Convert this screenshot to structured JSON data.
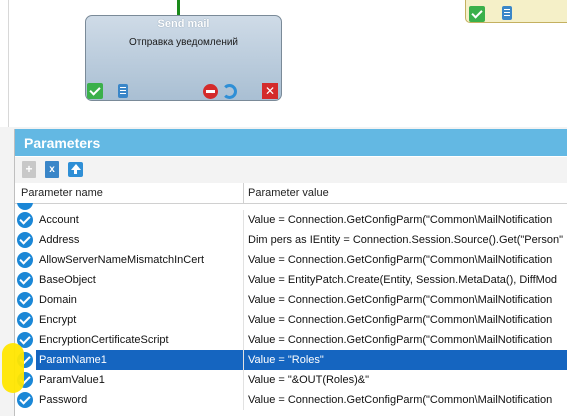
{
  "canvas": {
    "send_mail_node": {
      "title": "Send mail",
      "subtitle": "Отправка уведомлений",
      "close_glyph": "✕"
    }
  },
  "parameters_panel": {
    "title": "Parameters",
    "toolbar": {
      "add_glyph": "+",
      "delete_glyph": "x"
    },
    "columns": {
      "name": "Parameter name",
      "value": "Parameter value"
    },
    "rows": [
      {
        "name": "Account",
        "value": "Value = Connection.GetConfigParm(\"Common\\MailNotification"
      },
      {
        "name": "Address",
        "value": "Dim pers as IEntity = Connection.Session.Source().Get(\"Person\""
      },
      {
        "name": "AllowServerNameMismatchInCert",
        "value": "Value = Connection.GetConfigParm(\"Common\\MailNotification"
      },
      {
        "name": "BaseObject",
        "value": "Value = EntityPatch.Create(Entity, Session.MetaData(), DiffMod"
      },
      {
        "name": "Domain",
        "value": "Value = Connection.GetConfigParm(\"Common\\MailNotification"
      },
      {
        "name": "Encrypt",
        "value": "Value = Connection.GetConfigParm(\"Common\\MailNotification"
      },
      {
        "name": "EncryptionCertificateScript",
        "value": "Value = Connection.GetConfigParm(\"Common\\MailNotification"
      },
      {
        "name": "ParamName1",
        "value": "Value = \"Roles\"",
        "selected": true
      },
      {
        "name": "ParamValue1",
        "value": "Value = \"&OUT(Roles)&\""
      },
      {
        "name": "Password",
        "value": "Value = Connection.GetConfigParm(\"Common\\MailNotification"
      }
    ]
  },
  "colors": {
    "panel_header": "#63b8e3",
    "selected_row": "#1565c0",
    "check_icon": "#1b87d6",
    "annotation_highlight": "#ffe600"
  }
}
